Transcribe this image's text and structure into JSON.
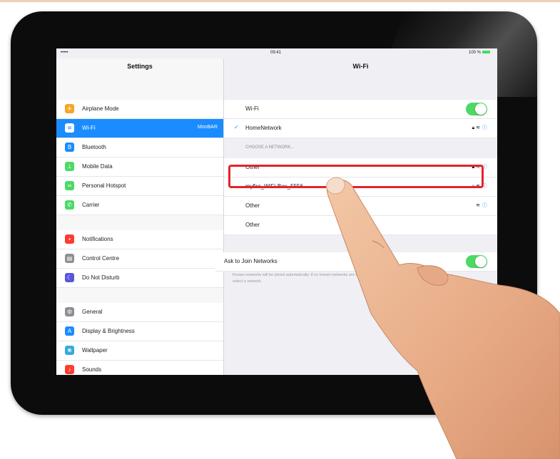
{
  "status_bar": {
    "carrier": "•••••  ",
    "time": "09:41",
    "battery": "100 %"
  },
  "master": {
    "title": "Settings",
    "items": [
      {
        "label": "Airplane Mode",
        "icon": "airplane-icon",
        "color": "#f5a623",
        "glyph": "✈"
      },
      {
        "label": "Wi-Fi",
        "value": "MonBAR",
        "icon": "wifi-icon",
        "color": "#1a8cff",
        "glyph": "≋",
        "selected": true
      },
      {
        "label": "Bluetooth",
        "icon": "bluetooth-icon",
        "color": "#1a8cff",
        "glyph": "B"
      },
      {
        "label": "Mobile Data",
        "icon": "antenna-icon",
        "color": "#4cd964",
        "glyph": "⊥"
      },
      {
        "label": "Personal Hotspot",
        "icon": "hotspot-icon",
        "color": "#4cd964",
        "glyph": "∞"
      },
      {
        "label": "Carrier",
        "icon": "phone-icon",
        "color": "#4cd964",
        "glyph": "✆"
      },
      {
        "label": "Notifications",
        "icon": "notifications-icon",
        "color": "#ff3b30",
        "glyph": "▪"
      },
      {
        "label": "Control Centre",
        "icon": "control-centre-icon",
        "color": "#8e8e93",
        "glyph": "▤"
      },
      {
        "label": "Do Not Disturb",
        "icon": "moon-icon",
        "color": "#5856d6",
        "glyph": "☾"
      },
      {
        "label": "General",
        "icon": "gear-icon",
        "color": "#8e8e93",
        "glyph": "⚙"
      },
      {
        "label": "Display & Brightness",
        "icon": "display-icon",
        "color": "#1a8cff",
        "glyph": "A"
      },
      {
        "label": "Wallpaper",
        "icon": "wallpaper-icon",
        "color": "#34aadc",
        "glyph": "❀"
      },
      {
        "label": "Sounds",
        "icon": "speaker-icon",
        "color": "#ff3b30",
        "glyph": "♪"
      }
    ]
  },
  "detail": {
    "title": "Wi-Fi",
    "wifi_label": "Wi-Fi",
    "connected_network": "HomeNetwork",
    "section_header": "CHOOSE A NETWORK...",
    "networks": [
      "Other",
      "myfire_WiFi-Box_5556",
      "Other",
      "Other"
    ],
    "ask_label": "Ask to Join Networks",
    "ask_description": "Known networks will be joined automatically. If no known networks are available, you will have to manually select a network."
  },
  "colors": {
    "accent": "#1a8cff",
    "toggle_on": "#4cd964",
    "highlight": "#e3232b"
  }
}
